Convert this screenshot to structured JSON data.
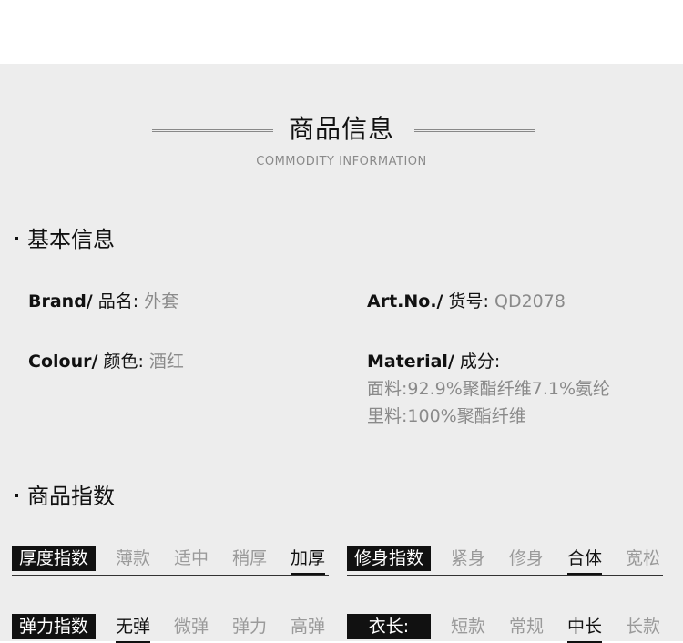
{
  "header": {
    "title": "商品信息",
    "subtitle": "COMMODITY INFORMATION"
  },
  "basic": {
    "heading": "基本信息",
    "brand": {
      "label_en": "Brand/",
      "label_cn": "品名:",
      "value": "外套"
    },
    "art": {
      "label_en": "Art.No./",
      "label_cn": "货号:",
      "value": "QD2078"
    },
    "colour": {
      "label_en": "Colour/",
      "label_cn": "颜色:",
      "value": "酒红"
    },
    "material": {
      "label_en": "Material/",
      "label_cn": "成分:",
      "line1": "面料:92.9%聚酯纤维7.1%氨纶",
      "line2": "里料:100%聚酯纤维"
    }
  },
  "indices": {
    "heading": "商品指数",
    "thickness": {
      "label": "厚度指数",
      "options": [
        "薄款",
        "适中",
        "稍厚",
        "加厚"
      ],
      "selected": "加厚"
    },
    "fit": {
      "label": "修身指数",
      "options": [
        "紧身",
        "修身",
        "合体",
        "宽松"
      ],
      "selected": "合体"
    },
    "elasticity": {
      "label": "弹力指数",
      "options": [
        "无弹",
        "微弹",
        "弹力",
        "高弹"
      ],
      "selected": "无弹"
    },
    "length": {
      "label": "衣长:",
      "options": [
        "短款",
        "常规",
        "中长",
        "长款"
      ],
      "selected": "中长"
    }
  }
}
